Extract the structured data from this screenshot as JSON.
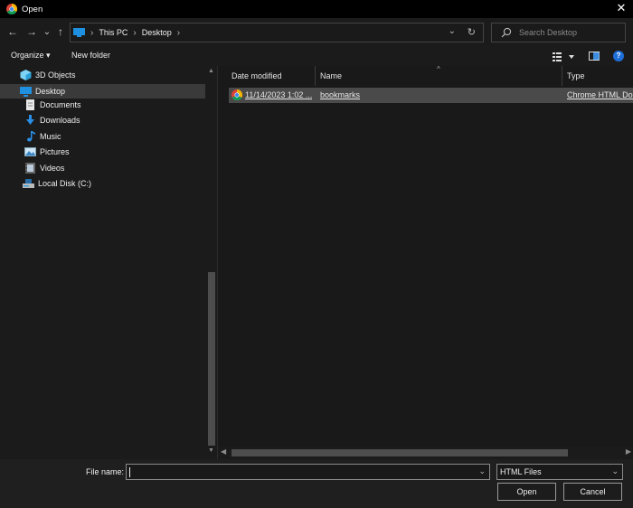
{
  "window": {
    "title": "Open",
    "close_glyph": "✕"
  },
  "nav": {
    "back_glyph": "←",
    "forward_glyph": "→",
    "recent_glyph": "⌄",
    "up_glyph": "↑",
    "breadcrumb": [
      "This PC",
      "Desktop"
    ],
    "separator": "›",
    "refresh_glyph": "↻",
    "search_placeholder": "Search Desktop"
  },
  "toolbar": {
    "organize_label": "Organize ▾",
    "new_folder_label": "New folder",
    "help_glyph": "?"
  },
  "sidebar": {
    "items": [
      {
        "label": "3D Objects",
        "icon": "cube-icon"
      },
      {
        "label": "Desktop",
        "icon": "desktop-icon",
        "selected": true
      },
      {
        "label": "Documents",
        "icon": "documents-icon"
      },
      {
        "label": "Downloads",
        "icon": "downloads-icon"
      },
      {
        "label": "Music",
        "icon": "music-icon"
      },
      {
        "label": "Pictures",
        "icon": "pictures-icon"
      },
      {
        "label": "Videos",
        "icon": "videos-icon"
      },
      {
        "label": "Local Disk (C:)",
        "icon": "disk-icon"
      }
    ]
  },
  "files": {
    "columns": {
      "date": "Date modified",
      "name": "Name",
      "type": "Type"
    },
    "rows": [
      {
        "date": "11/14/2023 1:02 ...",
        "name": "bookmarks",
        "type": "Chrome HTML Do..."
      }
    ]
  },
  "footer": {
    "file_name_label": "File name:",
    "file_name_value": "",
    "filter_value": "HTML Files",
    "open_label": "Open",
    "cancel_label": "Cancel"
  },
  "colors": {
    "accent": "#1e6fd9",
    "background": "#1b1b1b",
    "selection": "#4a4a4a"
  }
}
